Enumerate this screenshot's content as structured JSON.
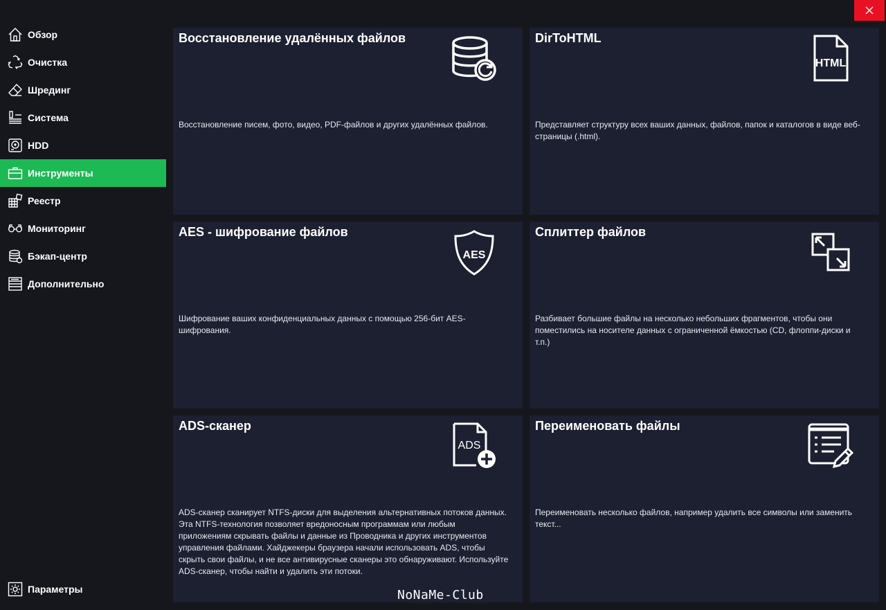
{
  "window": {
    "close_label": "✕"
  },
  "sidebar": {
    "items": [
      {
        "label": "Обзор",
        "icon": "home-icon"
      },
      {
        "label": "Очистка",
        "icon": "recycle-icon"
      },
      {
        "label": "Шрединг",
        "icon": "eraser-icon"
      },
      {
        "label": "Система",
        "icon": "system-icon"
      },
      {
        "label": "HDD",
        "icon": "hdd-icon"
      },
      {
        "label": "Инструменты",
        "icon": "toolbox-icon",
        "active": true
      },
      {
        "label": "Реестр",
        "icon": "registry-icon"
      },
      {
        "label": "Мониторинг",
        "icon": "eye-icon"
      },
      {
        "label": "Бэкап-центр",
        "icon": "database-icon"
      },
      {
        "label": "Дополнительно",
        "icon": "list-icon"
      }
    ],
    "settings": {
      "label": "Параметры",
      "icon": "gear-icon"
    },
    "accent_color": "#1db954"
  },
  "tools": [
    {
      "title": "Восстановление удалённых файлов",
      "icon": "database-restore-icon",
      "description": "Восстановление писем, фото, видео, PDF-файлов и других удалённых файлов."
    },
    {
      "title": "DirToHTML",
      "icon": "html-file-icon",
      "icon_text": "HTML",
      "description": "Представляет структуру всех ваших данных, файлов, папок и каталогов в виде веб-страницы (.html)."
    },
    {
      "title": "AES - шифрование файлов",
      "icon": "aes-shield-icon",
      "icon_text": "AES",
      "description": "Шифрование ваших конфиденциальных данных с помощью 256-бит AES-шифрования."
    },
    {
      "title": "Сплиттер файлов",
      "icon": "split-files-icon",
      "description": "Разбивает большие файлы на несколько небольших фрагментов, чтобы они поместились на носителе данных с ограниченной ёмкостью (CD, флоппи-диски и т.п.)"
    },
    {
      "title": "ADS-сканер",
      "icon": "ads-file-add-icon",
      "icon_text": "ADS",
      "description": "ADS-сканер сканирует NTFS-диски для выделения альтернативных потоков данных. Эта NTFS-технология позволяет вредоносным программам или любым приложениям скрывать файлы и данные из Проводника и других инструментов управления файлами. Хайджекеры браузера начали использовать ADS, чтобы скрыть свои файлы, и не все антивирусные сканеры это обнаруживают. Используйте ADS-сканер, чтобы найти и удалить эти потоки."
    },
    {
      "title": "Переименовать файлы",
      "icon": "rename-list-icon",
      "description": "Переименовать несколько файлов, например удалить все символы или заменить текст..."
    }
  ],
  "watermark": "NoNaMe-Club"
}
